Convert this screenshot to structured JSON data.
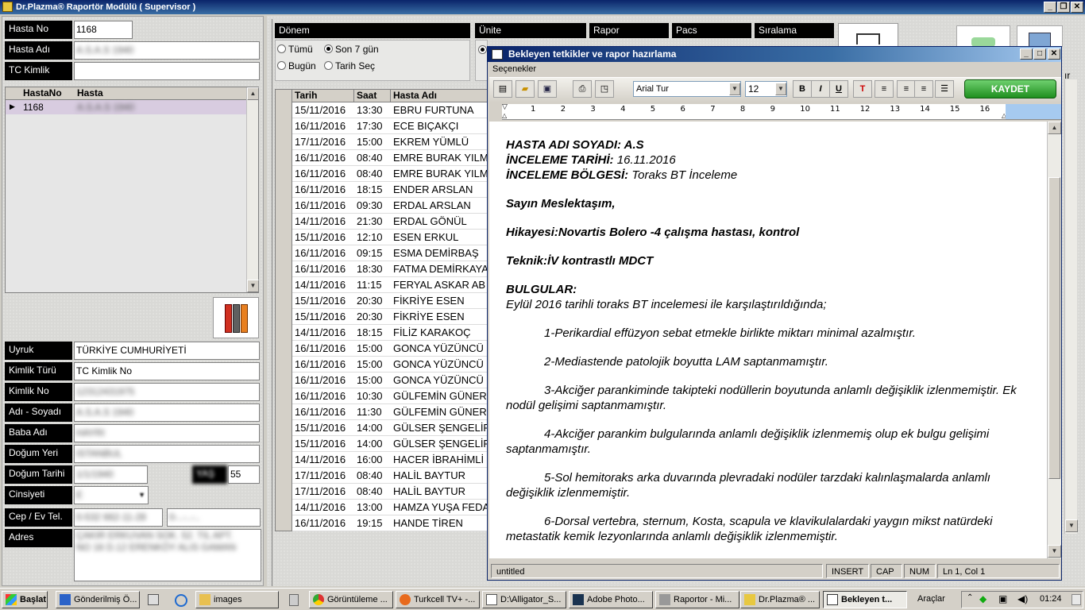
{
  "window": {
    "title": "Dr.Plazma® Raportör Modülü ( Supervisor )"
  },
  "left": {
    "hasta_no_label": "Hasta No",
    "hasta_no": "1168",
    "hasta_adi_label": "Hasta Adı",
    "hasta_adi": "A.S.A.S 1940",
    "tc_kimlik_label": "TC Kimlik",
    "tc_kimlik": "",
    "grid": {
      "col1": "HastaNo",
      "col2": "Hasta",
      "row_no": "1168",
      "row_name": "A.S.A.S 1940"
    },
    "fields": [
      {
        "label": "Uyruk",
        "value": "TÜRKİYE CUMHURİYETİ"
      },
      {
        "label": "Kimlik Türü",
        "value": "TC Kimlik No"
      },
      {
        "label": "Kimlik No",
        "value": "12312431975"
      },
      {
        "label": "Adı - Soyadı",
        "value": "A.S.A.S 1940"
      },
      {
        "label": "Baba Adı",
        "value": "HAYRI"
      },
      {
        "label": "Doğum Yeri",
        "value": "ISTANBUL"
      },
      {
        "label": "Doğum Tarihi",
        "value": "1/1/1940"
      },
      {
        "label": "Cinsiyeti",
        "value": "E"
      },
      {
        "label": "Cep / Ev Tel.",
        "value": "0-532 662-11-28"
      },
      {
        "label": "Adres",
        "value": "ÇAKIR ERKUVAN SOK. 52. TIL APT. NO 16 D.12 ERENKÖY ALIS GAMAN"
      }
    ],
    "yas_label": "YAŞ",
    "yas": "55",
    "tel2": "0-..-..-.."
  },
  "filters": {
    "donem": "Dönem",
    "unite": "Ünite",
    "rapor": "Rapor",
    "pacs": "Pacs",
    "siralama": "Sıralama",
    "tumu": "Tümü",
    "son7": "Son 7 gün",
    "bugun": "Bugün",
    "tarih_sec": "Tarih Seç"
  },
  "table": {
    "headers": [
      "Tarih",
      "Saat",
      "Hasta Adı"
    ],
    "rows": [
      [
        "15/11/2016",
        "13:30",
        "EBRU FURTUNA"
      ],
      [
        "16/11/2016",
        "17:30",
        "ECE BIÇAKÇI"
      ],
      [
        "17/11/2016",
        "15:00",
        "EKREM YÜMLÜ"
      ],
      [
        "16/11/2016",
        "08:40",
        "EMRE BURAK YILM"
      ],
      [
        "16/11/2016",
        "08:40",
        "EMRE BURAK YILM"
      ],
      [
        "16/11/2016",
        "18:15",
        "ENDER ARSLAN"
      ],
      [
        "16/11/2016",
        "09:30",
        "ERDAL ARSLAN"
      ],
      [
        "14/11/2016",
        "21:30",
        "ERDAL GÖNÜL"
      ],
      [
        "15/11/2016",
        "12:10",
        "ESEN ERKUL"
      ],
      [
        "16/11/2016",
        "09:15",
        "ESMA DEMİRBAŞ"
      ],
      [
        "16/11/2016",
        "18:30",
        "FATMA DEMİRKAYA"
      ],
      [
        "14/11/2016",
        "11:15",
        "FERYAL ASKAR AB"
      ],
      [
        "15/11/2016",
        "20:30",
        "FİKRİYE ESEN"
      ],
      [
        "15/11/2016",
        "20:30",
        "FİKRİYE ESEN"
      ],
      [
        "14/11/2016",
        "18:15",
        "FİLİZ KARAKOÇ"
      ],
      [
        "16/11/2016",
        "15:00",
        "GONCA YÜZÜNCÜ"
      ],
      [
        "16/11/2016",
        "15:00",
        "GONCA YÜZÜNCÜ"
      ],
      [
        "16/11/2016",
        "15:00",
        "GONCA YÜZÜNCÜ"
      ],
      [
        "16/11/2016",
        "10:30",
        "GÜLFEMİN GÜNER"
      ],
      [
        "16/11/2016",
        "11:30",
        "GÜLFEMİN GÜNER"
      ],
      [
        "15/11/2016",
        "14:00",
        "GÜLSER ŞENGELİF"
      ],
      [
        "15/11/2016",
        "14:00",
        "GÜLSER ŞENGELİF"
      ],
      [
        "14/11/2016",
        "16:00",
        "HACER İBRAHİMLİ"
      ],
      [
        "17/11/2016",
        "08:40",
        "HALİL BAYTUR"
      ],
      [
        "17/11/2016",
        "08:40",
        "HALİL BAYTUR"
      ],
      [
        "14/11/2016",
        "13:00",
        "HAMZA YUŞA FEDA"
      ],
      [
        "16/11/2016",
        "19:15",
        "HANDE TİREN"
      ]
    ]
  },
  "dialog": {
    "title": "Bekleyen tetkikler ve rapor hazırlama",
    "menu": "Seçenekler",
    "font": "Arial Tur",
    "size": "12",
    "save": "KAYDET",
    "ruler_nums": [
      "1",
      "2",
      "3",
      "4",
      "5",
      "6",
      "7",
      "8",
      "9",
      "10",
      "11",
      "12",
      "13",
      "14",
      "15",
      "16"
    ],
    "doc": {
      "l1a": "HASTA ADI SOYADI: A.S",
      "l2a": "İNCELEME TARİHİ:",
      "l2b": " 16.11.2016",
      "l3a": "İNCELEME BÖLGESİ:",
      "l3b": " Toraks BT İnceleme",
      "greet": "Sayın Meslektaşım,",
      "hist": "Hikayesi:Novartis Bolero -4  çalışma hastası, kontrol",
      "tech": "Teknik:İV kontrastlı MDCT",
      "find": "BULGULAR:",
      "intro": "Eylül  2016    tarihli toraks  BT incelemesi  ile karşılaştırıldığında;",
      "i1": "1-Perikardial  effüzyon  sebat etmekle  birlikte  miktarı   minimal  azalmıştır.",
      "i2": "2-Mediastende patolojik boyutta LAM  saptanmamıştır.",
      "i3": "3-Akciğer  parankiminde takipteki    nodüllerin   boyutunda  anlamlı  değişiklik izlenmemiştir. Ek  nodül  gelişimi  saptanmamıştır.",
      "i4": "4-Akciğer parankim  bulgularında  anlamlı  değişiklik  izlenmemiş olup   ek bulgu gelişimi  saptanmamıştır.",
      "i5": "5-Sol   hemitoraks  arka duvarında   plevradaki  nodüler  tarzdaki  kalınlaşmalarda anlamlı  değişiklik izlenmemiştir.",
      "i6": "6-Dorsal vertebra,  sternum, Kosta, scapula  ve klavikulalardaki   yaygın  mikst natürdeki metastatik kemik  lezyonlarında anlamlı  değişiklik izlenmemiştir."
    },
    "status": {
      "file": "untitled",
      "ins": "INSERT",
      "cap": "CAP",
      "num": "NUM",
      "pos": "Ln 1, Col 1"
    }
  },
  "taskbar": {
    "start": "Başlat",
    "tasks": [
      "Gönderilmiş Ö...",
      "images",
      "Görüntüleme ...",
      "Turkcell TV+ -...",
      "D:\\Alligator_S...",
      "Adobe Photo...",
      "Raportor - Mi...",
      "Dr.Plazma® ...",
      "Bekleyen t..."
    ],
    "araclar": "Araçlar",
    "clock": "01:24"
  }
}
